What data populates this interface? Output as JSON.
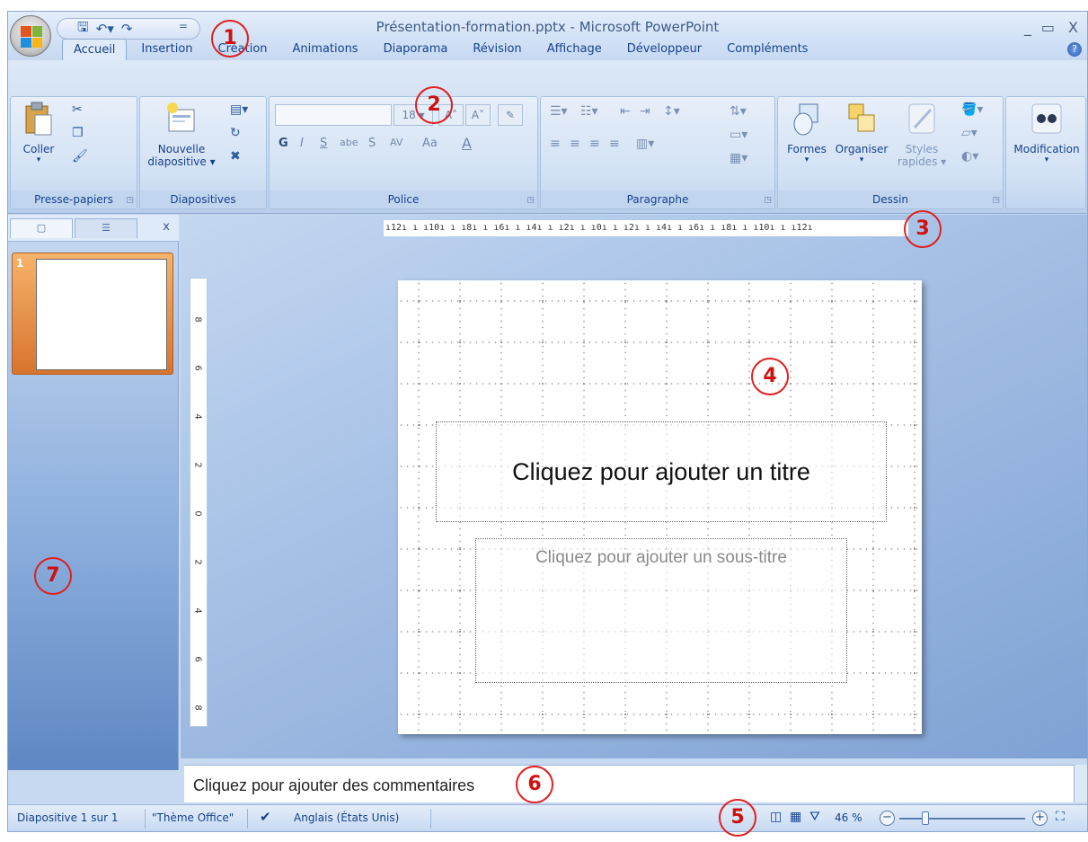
{
  "window": {
    "title": "Présentation-formation.pptx - Microsoft PowerPoint",
    "minimize": "_",
    "maximize": "▭",
    "close": "X"
  },
  "quick_access": {
    "save_icon": "save-icon",
    "undo_icon": "undo-icon",
    "redo_icon": "redo-icon",
    "more": "="
  },
  "tabs": [
    {
      "label": "Accueil",
      "active": true
    },
    {
      "label": "Insertion"
    },
    {
      "label": "Création"
    },
    {
      "label": "Animations"
    },
    {
      "label": "Diaporama"
    },
    {
      "label": "Révision"
    },
    {
      "label": "Affichage"
    },
    {
      "label": "Développeur"
    },
    {
      "label": "Compléments"
    }
  ],
  "ribbon": {
    "clipboard": {
      "label": "Presse-papiers",
      "paste": "Coller"
    },
    "slides": {
      "label": "Diapositives",
      "new_slide_1": "Nouvelle",
      "new_slide_2": "diapositive"
    },
    "font": {
      "label": "Police",
      "size": "18",
      "bold": "G",
      "italic": "I",
      "underline": "S",
      "strike": "abe",
      "shadow": "S",
      "spacing": "AV",
      "case": "Aa",
      "color": "A"
    },
    "paragraph": {
      "label": "Paragraphe"
    },
    "drawing": {
      "label": "Dessin",
      "shapes": "Formes",
      "arrange": "Organiser",
      "styles_1": "Styles",
      "styles_2": "rapides"
    },
    "editing": {
      "label": "Modification"
    }
  },
  "ruler": {
    "horizontal": "ı12ı ı ı10ı ı ı8ı ı ı6ı ı ı4ı ı ı2ı ı ı0ı ı ı2ı ı ı4ı ı ı6ı ı ı8ı ı ı10ı ı ı12ı",
    "vertical": [
      "8",
      "6",
      "4",
      "2",
      "0",
      "2",
      "4",
      "6",
      "8"
    ]
  },
  "slide_pane": {
    "close": "x",
    "thumbnails": [
      {
        "number": "1"
      }
    ]
  },
  "slide": {
    "title_placeholder": "Cliquez pour ajouter un titre",
    "subtitle_placeholder": "Cliquez pour ajouter un sous-titre"
  },
  "notes": {
    "placeholder": "Cliquez pour ajouter des commentaires"
  },
  "status_bar": {
    "slide_info": "Diapositive 1 sur 1",
    "theme": "\"Thème Office\"",
    "language": "Anglais (États Unis)",
    "zoom": "46 %",
    "zoom_minus": "−",
    "zoom_plus": "+"
  },
  "annotations": [
    "1",
    "2",
    "3",
    "4",
    "5",
    "6",
    "7"
  ],
  "colors": {
    "accent": "#15428b",
    "annotation": "#e02020",
    "slide_thumb": "#e08a3c"
  }
}
